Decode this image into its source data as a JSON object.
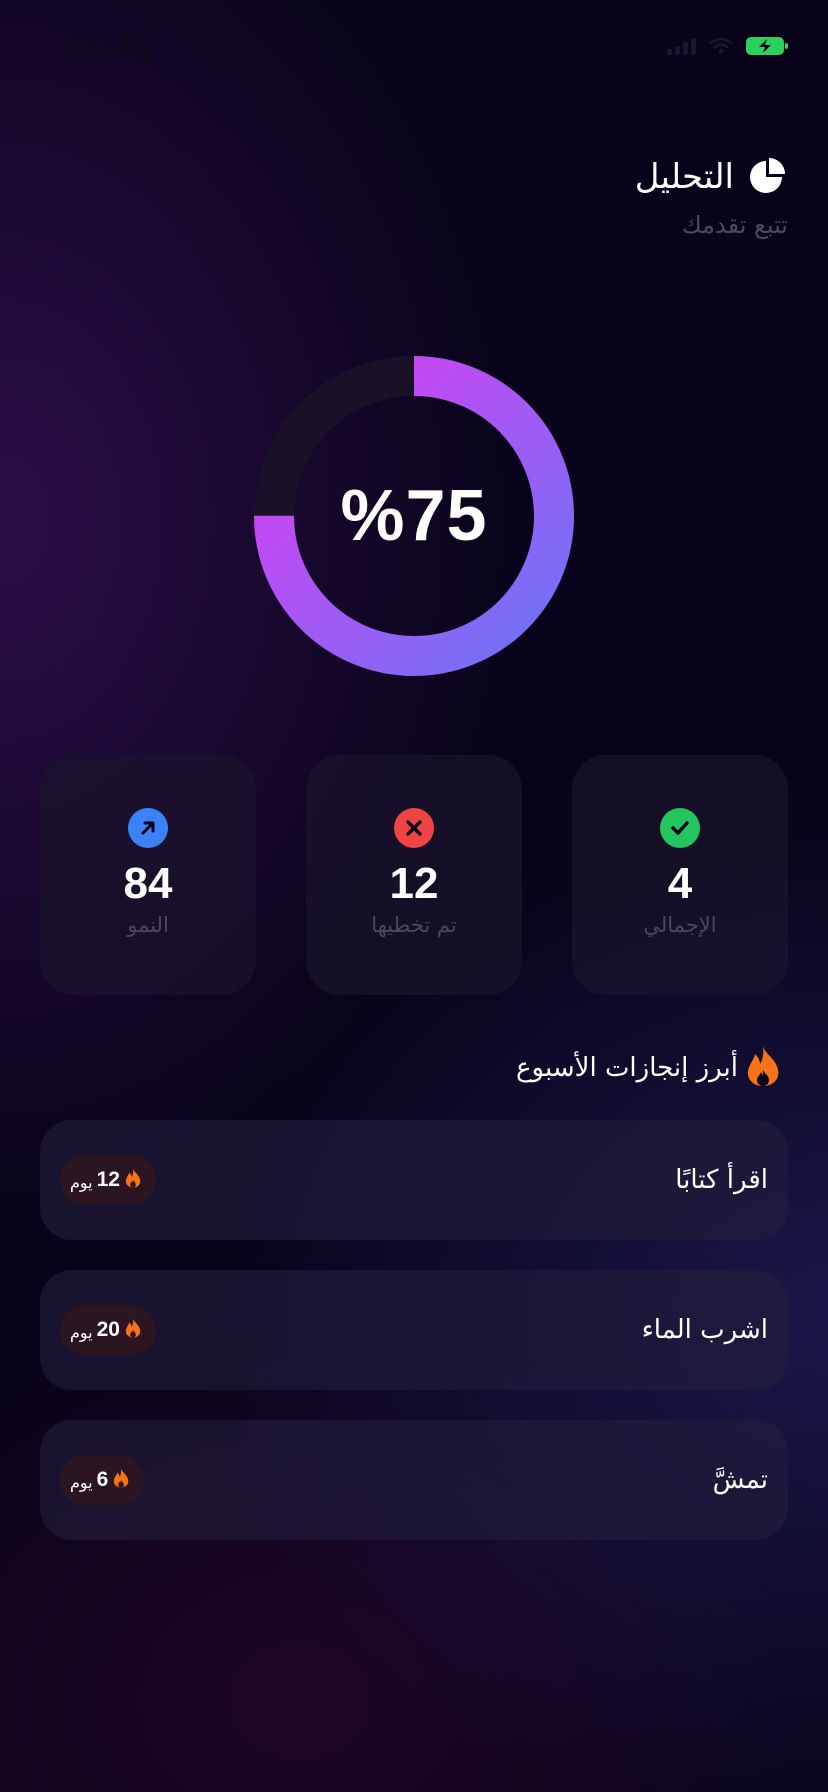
{
  "status_bar": {
    "time": "16:41"
  },
  "header": {
    "title": "التحليل",
    "subtitle": "تتبع تقدمك",
    "icon": "pie-chart-icon"
  },
  "progress": {
    "display": "%75",
    "fraction": 0.75,
    "colors": {
      "start": "#df3cf2",
      "end": "#6b74f7",
      "track": "#181128"
    }
  },
  "stats": [
    {
      "value": "4",
      "label": "الإجمالي",
      "icon": "check-circle-icon",
      "color": "#22c55e"
    },
    {
      "value": "12",
      "label": "تم تخطيها",
      "icon": "x-circle-icon",
      "color": "#ef4444"
    },
    {
      "value": "84",
      "label": "النمو",
      "icon": "arrow-up-right-icon",
      "color": "#3b82f6"
    }
  ],
  "section": {
    "title": "أبرز إنجازات الأسبوع",
    "icon": "flame-icon"
  },
  "habits": [
    {
      "name": "اقرأ كتابًا",
      "streak": "12",
      "unit": "يوم"
    },
    {
      "name": "اشرب الماء",
      "streak": "20",
      "unit": "يوم"
    },
    {
      "name": "تمشَّ",
      "streak": "6",
      "unit": "يوم"
    }
  ],
  "colors": {
    "background": "#08031a",
    "flame": "#f97316",
    "card": "#1a142c"
  }
}
